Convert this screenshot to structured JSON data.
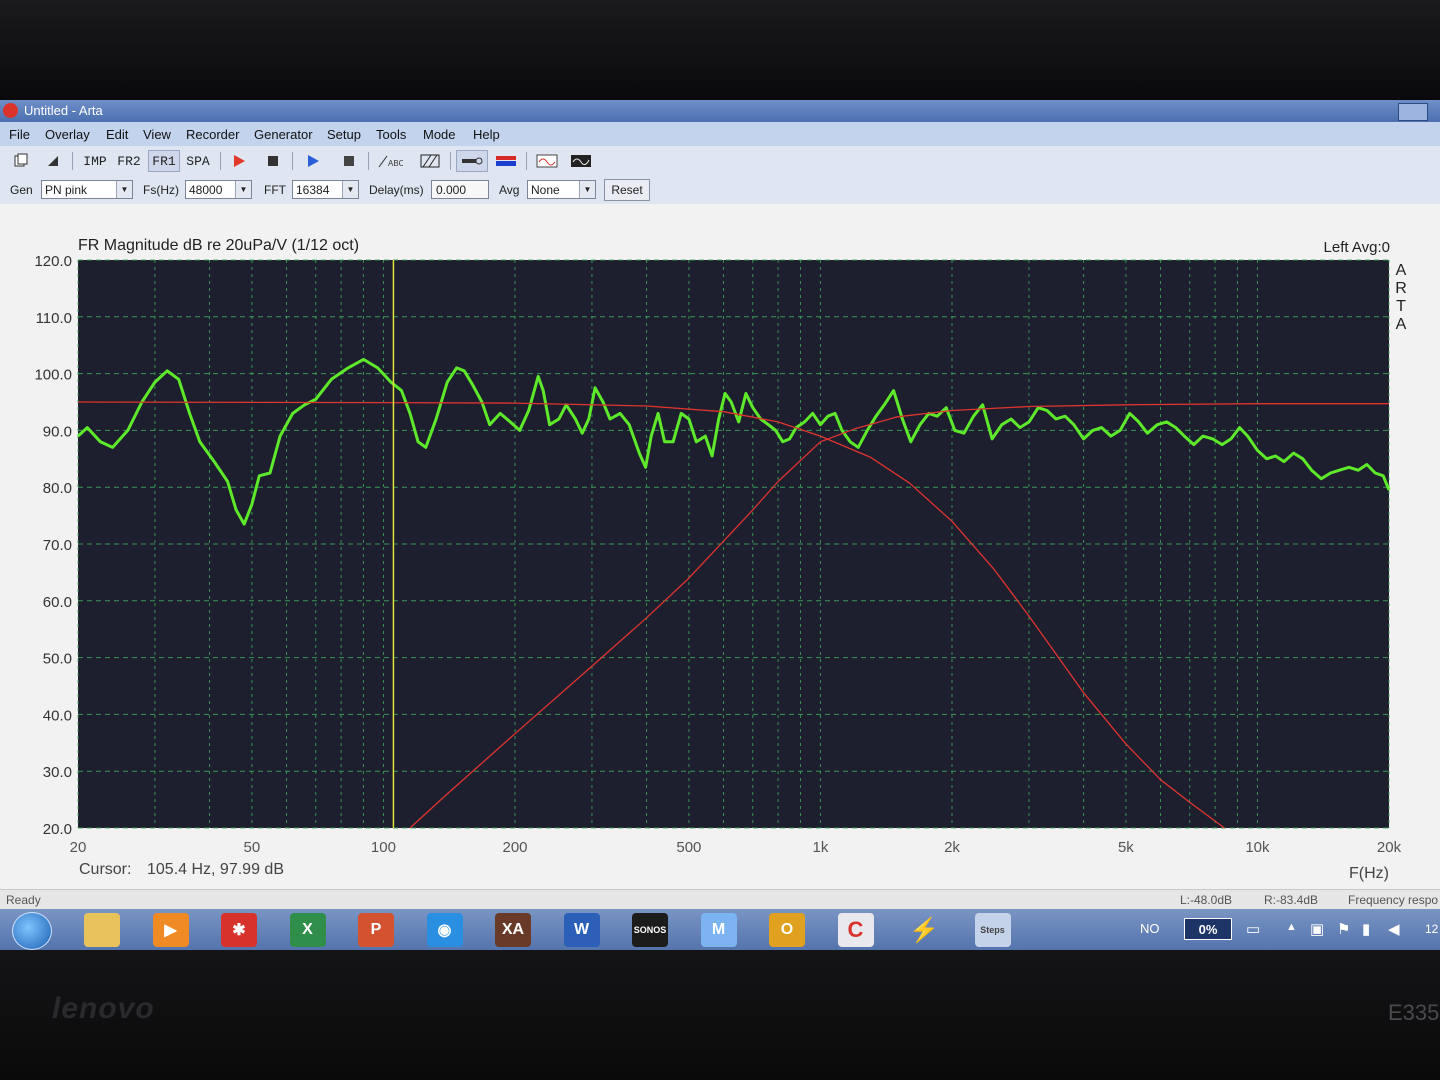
{
  "window": {
    "title": "Untitled - Arta"
  },
  "menu": [
    "File",
    "Overlay",
    "Edit",
    "View",
    "Recorder",
    "Generator",
    "Setup",
    "Tools",
    "Mode",
    "Help"
  ],
  "toolbar": {
    "imp_label": "IMP",
    "fr2_label": "FR2",
    "fr1_label": "FR1",
    "spa_label": "SPA",
    "icons": [
      "copy-icon",
      "paste-icon",
      "record-icon",
      "stop-icon",
      "play-icon",
      "stop-icon",
      "text-abc-icon",
      "hatch-icon",
      "probe-icon",
      "color-bar-icon",
      "waveform-icon",
      "scope-icon"
    ]
  },
  "generator_bar": {
    "gen_label": "Gen",
    "gen_value": "PN pink",
    "fs_label": "Fs(Hz)",
    "fs_value": "48000",
    "fft_label": "FFT",
    "fft_value": "16384",
    "delay_label": "Delay(ms)",
    "delay_value": "0.000",
    "avg_label": "Avg",
    "avg_value": "None",
    "reset_label": "Reset"
  },
  "graph": {
    "header_left": "FR Magnitude dB re 20uPa/V (1/12 oct)",
    "header_right": "Left  Avg:0",
    "brand_letters": [
      "A",
      "R",
      "T",
      "A"
    ],
    "cursor_label": "Cursor:",
    "cursor_value": "105.4 Hz, 97.99 dB",
    "x_unit": "F(Hz)"
  },
  "chart_data": {
    "type": "line",
    "x_scale": "log",
    "xlim": [
      20,
      20000
    ],
    "ylim": [
      20,
      120
    ],
    "y_ticks": [
      "20.0",
      "30.0",
      "40.0",
      "50.0",
      "60.0",
      "70.0",
      "80.0",
      "90.0",
      "100.0",
      "110.0",
      "120.0"
    ],
    "x_ticks": [
      {
        "value": 20,
        "label": "20"
      },
      {
        "value": 50,
        "label": "50"
      },
      {
        "value": 100,
        "label": "100"
      },
      {
        "value": 200,
        "label": "200"
      },
      {
        "value": 500,
        "label": "500"
      },
      {
        "value": 1000,
        "label": "1k"
      },
      {
        "value": 2000,
        "label": "2k"
      },
      {
        "value": 5000,
        "label": "5k"
      },
      {
        "value": 10000,
        "label": "10k"
      },
      {
        "value": 20000,
        "label": "20k"
      }
    ],
    "grid": true,
    "cursor_x": 105.4,
    "colors": {
      "background": "#1d1f2e",
      "grid": "#3ca55c",
      "measured": "#5eea2a",
      "filter": "#e0342e",
      "cursor": "#e2e23a"
    },
    "series": [
      {
        "role": "measured",
        "color": "#5eea2a",
        "points": [
          [
            20,
            89
          ],
          [
            21,
            90.5
          ],
          [
            22.5,
            88
          ],
          [
            24,
            87
          ],
          [
            26,
            90
          ],
          [
            28,
            95
          ],
          [
            30,
            98.5
          ],
          [
            32,
            100.5
          ],
          [
            34,
            99
          ],
          [
            36,
            93
          ],
          [
            38,
            88
          ],
          [
            41,
            84.5
          ],
          [
            44,
            81
          ],
          [
            46,
            76
          ],
          [
            48,
            73.5
          ],
          [
            50,
            77
          ],
          [
            52,
            82
          ],
          [
            55,
            82.5
          ],
          [
            58,
            89
          ],
          [
            62,
            93
          ],
          [
            66,
            94.5
          ],
          [
            70,
            95.5
          ],
          [
            76,
            99
          ],
          [
            83,
            101
          ],
          [
            90,
            102.5
          ],
          [
            97,
            101
          ],
          [
            104,
            98.5
          ],
          [
            110,
            97
          ],
          [
            115,
            93
          ],
          [
            120,
            88
          ],
          [
            125,
            87
          ],
          [
            132,
            92
          ],
          [
            140,
            98.5
          ],
          [
            147,
            101
          ],
          [
            153,
            100.5
          ],
          [
            160,
            98
          ],
          [
            168,
            95
          ],
          [
            175,
            91
          ],
          [
            185,
            93
          ],
          [
            195,
            91.5
          ],
          [
            205,
            90
          ],
          [
            215,
            93.5
          ],
          [
            226,
            99.5
          ],
          [
            232,
            97
          ],
          [
            240,
            91
          ],
          [
            252,
            92
          ],
          [
            262,
            94.5
          ],
          [
            275,
            92
          ],
          [
            285,
            89.5
          ],
          [
            295,
            92
          ],
          [
            305,
            97.5
          ],
          [
            318,
            95
          ],
          [
            330,
            92
          ],
          [
            348,
            93
          ],
          [
            365,
            91
          ],
          [
            385,
            86
          ],
          [
            398,
            83.5
          ],
          [
            410,
            89
          ],
          [
            425,
            93
          ],
          [
            440,
            88
          ],
          [
            460,
            88
          ],
          [
            480,
            93
          ],
          [
            500,
            92
          ],
          [
            520,
            88
          ],
          [
            545,
            89
          ],
          [
            565,
            85.5
          ],
          [
            585,
            92
          ],
          [
            605,
            96.5
          ],
          [
            625,
            95
          ],
          [
            650,
            91.5
          ],
          [
            675,
            96.5
          ],
          [
            700,
            94
          ],
          [
            730,
            92
          ],
          [
            760,
            91
          ],
          [
            790,
            90
          ],
          [
            820,
            88
          ],
          [
            850,
            88.5
          ],
          [
            880,
            90.5
          ],
          [
            920,
            91.5
          ],
          [
            960,
            93
          ],
          [
            1000,
            91
          ],
          [
            1040,
            92.5
          ],
          [
            1080,
            93
          ],
          [
            1120,
            90
          ],
          [
            1170,
            88
          ],
          [
            1220,
            87
          ],
          [
            1280,
            90
          ],
          [
            1340,
            92.5
          ],
          [
            1400,
            94.5
          ],
          [
            1470,
            97
          ],
          [
            1540,
            92
          ],
          [
            1610,
            88
          ],
          [
            1690,
            91
          ],
          [
            1770,
            93
          ],
          [
            1850,
            92.5
          ],
          [
            1940,
            94
          ],
          [
            2030,
            90
          ],
          [
            2130,
            89.5
          ],
          [
            2240,
            92.5
          ],
          [
            2350,
            94.5
          ],
          [
            2470,
            88.5
          ],
          [
            2600,
            91
          ],
          [
            2730,
            92
          ],
          [
            2860,
            90.5
          ],
          [
            3000,
            91.5
          ],
          [
            3150,
            94
          ],
          [
            3300,
            93.5
          ],
          [
            3460,
            92
          ],
          [
            3630,
            92.5
          ],
          [
            3800,
            91
          ],
          [
            4000,
            88.5
          ],
          [
            4200,
            90
          ],
          [
            4400,
            90.5
          ],
          [
            4620,
            89
          ],
          [
            4850,
            90
          ],
          [
            5100,
            93
          ],
          [
            5350,
            91.5
          ],
          [
            5600,
            89.5
          ],
          [
            5900,
            91
          ],
          [
            6200,
            91.5
          ],
          [
            6500,
            90.5
          ],
          [
            6800,
            89
          ],
          [
            7150,
            87.5
          ],
          [
            7500,
            89
          ],
          [
            7900,
            88.5
          ],
          [
            8300,
            87.5
          ],
          [
            8700,
            88.5
          ],
          [
            9100,
            90.5
          ],
          [
            9500,
            89
          ],
          [
            10000,
            86.5
          ],
          [
            10500,
            85
          ],
          [
            11000,
            85.5
          ],
          [
            11500,
            84.5
          ],
          [
            12100,
            86
          ],
          [
            12700,
            85
          ],
          [
            13300,
            83
          ],
          [
            14000,
            81.5
          ],
          [
            14700,
            82.5
          ],
          [
            15400,
            83
          ],
          [
            16200,
            83.5
          ],
          [
            17000,
            83
          ],
          [
            17800,
            84
          ],
          [
            18600,
            82.5
          ],
          [
            19400,
            82
          ],
          [
            20000,
            79.5
          ]
        ]
      },
      {
        "role": "filter-lowpass",
        "color": "#e0342e",
        "points": [
          [
            20,
            95
          ],
          [
            100,
            94.9
          ],
          [
            200,
            94.8
          ],
          [
            400,
            94.3
          ],
          [
            600,
            93.3
          ],
          [
            800,
            91.5
          ],
          [
            1000,
            89
          ],
          [
            1300,
            85.3
          ],
          [
            1600,
            80.7
          ],
          [
            2000,
            74
          ],
          [
            2500,
            65.5
          ],
          [
            3000,
            57.3
          ],
          [
            4000,
            43.8
          ],
          [
            5000,
            34.8
          ],
          [
            6000,
            28.5
          ],
          [
            7000,
            24.5
          ],
          [
            8400,
            20
          ]
        ]
      },
      {
        "role": "filter-highpass",
        "color": "#e0342e",
        "points": [
          [
            115,
            20
          ],
          [
            140,
            26
          ],
          [
            200,
            36.6
          ],
          [
            300,
            48.5
          ],
          [
            400,
            57
          ],
          [
            500,
            64
          ],
          [
            700,
            76
          ],
          [
            800,
            81
          ],
          [
            1000,
            88
          ],
          [
            1200,
            90.3
          ],
          [
            1500,
            92.4
          ],
          [
            2000,
            93.5
          ],
          [
            3000,
            94.2
          ],
          [
            5000,
            94.5
          ],
          [
            10000,
            94.7
          ],
          [
            20000,
            94.7
          ]
        ]
      }
    ]
  },
  "status": {
    "left": "Ready",
    "l_level": "L:-48.0dB",
    "r_level": "R:-83.4dB",
    "mode": "Frequency respo"
  },
  "taskbar": {
    "apps": [
      {
        "name": "explorer",
        "glyph": "",
        "color": "#e8c25a"
      },
      {
        "name": "media",
        "glyph": "▶",
        "color": "#f08a24"
      },
      {
        "name": "app-red",
        "glyph": "✱",
        "color": "#d7322b"
      },
      {
        "name": "excel",
        "glyph": "X",
        "color": "#2f8f4a"
      },
      {
        "name": "powerpoint",
        "glyph": "P",
        "color": "#d35230"
      },
      {
        "name": "disc",
        "glyph": "◉",
        "color": "#2a8fe0"
      },
      {
        "name": "xa",
        "glyph": "XA",
        "color": "#6a3a28"
      },
      {
        "name": "word",
        "glyph": "W",
        "color": "#2b5fb8"
      },
      {
        "name": "sonos",
        "glyph": "SONOS",
        "color": "#1c1c1c"
      },
      {
        "name": "m-app",
        "glyph": "M",
        "color": "#7bb4f0"
      },
      {
        "name": "outlook",
        "glyph": "O",
        "color": "#e0a020"
      },
      {
        "name": "arta",
        "glyph": "C",
        "color": "#e8e8ee"
      },
      {
        "name": "lightning",
        "glyph": "⚡",
        "color": "#3a5da0"
      },
      {
        "name": "steps",
        "glyph": "Steps",
        "color": "#c5d3ea"
      }
    ],
    "lang": "NO",
    "cpu": "0%",
    "clock_partial": "12"
  }
}
